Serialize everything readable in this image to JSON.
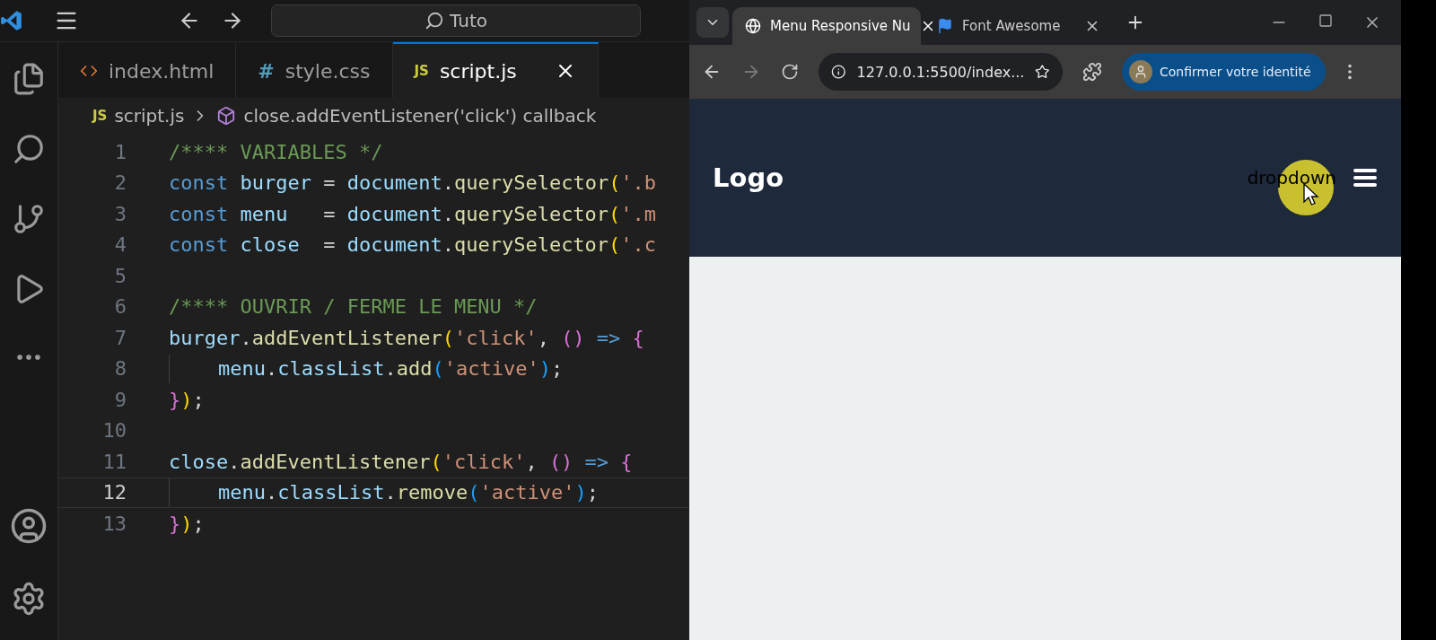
{
  "editor": {
    "search": "Tuto",
    "tabs": [
      {
        "kind": "html",
        "label": "index.html",
        "selected": false
      },
      {
        "kind": "css",
        "badge": "#",
        "label": "style.css",
        "selected": false
      },
      {
        "kind": "js",
        "badge": "JS",
        "label": "script.js",
        "selected": true
      }
    ],
    "breadcrumb": {
      "badge": "JS",
      "file": "script.js",
      "symbol": "close.addEventListener('click') callback"
    },
    "lines": [
      {
        "number": "1",
        "active": false,
        "indented": false,
        "tokens": [
          {
            "kind": "comment",
            "text": "/**** VARIABLES */"
          }
        ]
      },
      {
        "number": "2",
        "active": false,
        "indented": false,
        "tokens": [
          {
            "kind": "keyword",
            "text": "const "
          },
          {
            "kind": "var",
            "text": "burger"
          },
          {
            "kind": "plain",
            "text": " = "
          },
          {
            "kind": "var",
            "text": "document"
          },
          {
            "kind": "plain",
            "text": "."
          },
          {
            "kind": "func",
            "text": "querySelector"
          },
          {
            "kind": "bracket1",
            "text": "("
          },
          {
            "kind": "string",
            "text": "'.b"
          }
        ]
      },
      {
        "number": "3",
        "active": false,
        "indented": false,
        "tokens": [
          {
            "kind": "keyword",
            "text": "const "
          },
          {
            "kind": "var",
            "text": "menu"
          },
          {
            "kind": "plain",
            "text": "   = "
          },
          {
            "kind": "var",
            "text": "document"
          },
          {
            "kind": "plain",
            "text": "."
          },
          {
            "kind": "func",
            "text": "querySelector"
          },
          {
            "kind": "bracket1",
            "text": "("
          },
          {
            "kind": "string",
            "text": "'.m"
          }
        ]
      },
      {
        "number": "4",
        "active": false,
        "indented": false,
        "tokens": [
          {
            "kind": "keyword",
            "text": "const "
          },
          {
            "kind": "var",
            "text": "close"
          },
          {
            "kind": "plain",
            "text": "  = "
          },
          {
            "kind": "var",
            "text": "document"
          },
          {
            "kind": "plain",
            "text": "."
          },
          {
            "kind": "func",
            "text": "querySelector"
          },
          {
            "kind": "bracket1",
            "text": "("
          },
          {
            "kind": "string",
            "text": "'.c"
          }
        ]
      },
      {
        "number": "5",
        "active": false,
        "indented": false
      },
      {
        "number": "6",
        "active": false,
        "indented": false,
        "tokens": [
          {
            "kind": "comment",
            "text": "/**** OUVRIR / FERME LE MENU */"
          }
        ]
      },
      {
        "number": "7",
        "active": false,
        "indented": false,
        "tokens": [
          {
            "kind": "var",
            "text": "burger"
          },
          {
            "kind": "plain",
            "text": "."
          },
          {
            "kind": "func",
            "text": "addEventListener"
          },
          {
            "kind": "bracket1",
            "text": "("
          },
          {
            "kind": "string",
            "text": "'click'"
          },
          {
            "kind": "plain",
            "text": ", "
          },
          {
            "kind": "bracket2",
            "text": "()"
          },
          {
            "kind": "keyword",
            "text": " => "
          },
          {
            "kind": "bracket2",
            "text": "{"
          }
        ]
      },
      {
        "number": "8",
        "active": false,
        "indented": true,
        "tokens": [
          {
            "kind": "var",
            "text": "menu"
          },
          {
            "kind": "plain",
            "text": "."
          },
          {
            "kind": "var",
            "text": "classList"
          },
          {
            "kind": "plain",
            "text": "."
          },
          {
            "kind": "func",
            "text": "add"
          },
          {
            "kind": "bracket3",
            "text": "("
          },
          {
            "kind": "string",
            "text": "'active'"
          },
          {
            "kind": "bracket3",
            "text": ")"
          },
          {
            "kind": "plain",
            "text": ";"
          }
        ]
      },
      {
        "number": "9",
        "active": false,
        "indented": false,
        "tokens": [
          {
            "kind": "bracket2",
            "text": "}"
          },
          {
            "kind": "bracket1",
            "text": ")"
          },
          {
            "kind": "plain",
            "text": ";"
          }
        ]
      },
      {
        "number": "10",
        "active": false,
        "indented": false
      },
      {
        "number": "11",
        "active": false,
        "indented": false,
        "tokens": [
          {
            "kind": "var",
            "text": "close"
          },
          {
            "kind": "plain",
            "text": "."
          },
          {
            "kind": "func",
            "text": "addEventListener"
          },
          {
            "kind": "bracket1",
            "text": "("
          },
          {
            "kind": "string",
            "text": "'click'"
          },
          {
            "kind": "plain",
            "text": ", "
          },
          {
            "kind": "bracket2",
            "text": "()"
          },
          {
            "kind": "keyword",
            "text": " => "
          },
          {
            "kind": "bracket2",
            "text": "{"
          }
        ]
      },
      {
        "number": "12",
        "active": true,
        "indented": true,
        "tokens": [
          {
            "kind": "var",
            "text": "menu"
          },
          {
            "kind": "plain",
            "text": "."
          },
          {
            "kind": "var",
            "text": "classList"
          },
          {
            "kind": "plain",
            "text": "."
          },
          {
            "kind": "func",
            "text": "remove"
          },
          {
            "kind": "bracket3",
            "text": "("
          },
          {
            "kind": "string",
            "text": "'active'"
          },
          {
            "kind": "bracket3",
            "text": ")"
          },
          {
            "kind": "plain",
            "text": ";"
          }
        ]
      },
      {
        "number": "13",
        "active": false,
        "indented": false,
        "tokens": [
          {
            "kind": "bracket2",
            "text": "}"
          },
          {
            "kind": "bracket1",
            "text": ")"
          },
          {
            "kind": "plain",
            "text": ";"
          }
        ]
      }
    ]
  },
  "browser": {
    "tabs": [
      {
        "kind": "globe",
        "title": "Menu Responsive Nu",
        "selected": true
      },
      {
        "kind": "flag",
        "title": "Font Awesome",
        "selected": false
      }
    ],
    "address": "127.0.0.1:5500/index...",
    "profile_button": "Confirmer votre identité",
    "page": {
      "logo": "Logo",
      "dropdown": "dropdown"
    }
  }
}
